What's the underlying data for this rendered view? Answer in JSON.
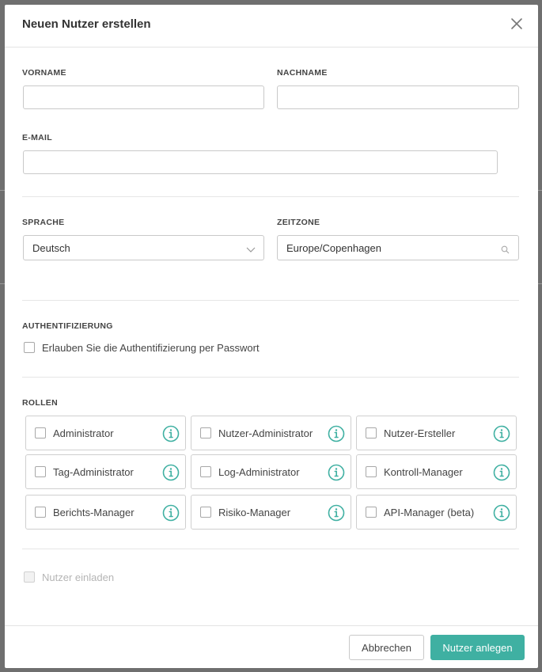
{
  "colors": {
    "accent": "#3fb0a2",
    "border": "#c9c9c9",
    "overlay": "#6f6f6f"
  },
  "modal": {
    "title": "Neuen Nutzer erstellen",
    "close_icon": "close-icon"
  },
  "form": {
    "firstname": {
      "label": "VORNAME",
      "value": "",
      "placeholder": ""
    },
    "lastname": {
      "label": "NACHNAME",
      "value": "",
      "placeholder": ""
    },
    "email": {
      "label": "E-MAIL",
      "value": "",
      "placeholder": ""
    },
    "language": {
      "label": "SPRACHE",
      "value": "Deutsch",
      "icon": "chevron-down-icon"
    },
    "timezone": {
      "label": "ZEITZONE",
      "value": "Europe/Copenhagen",
      "icon": "search-icon"
    },
    "auth": {
      "label": "AUTHENTIFIZIERUNG",
      "password_option": {
        "label": "Erlauben Sie die Authentifizierung per Passwort",
        "checked": false
      }
    },
    "roles": {
      "label": "ROLLEN",
      "items": [
        {
          "label": "Administrator",
          "checked": false,
          "icon": "info-icon"
        },
        {
          "label": "Nutzer-Administrator",
          "checked": false,
          "icon": "info-icon"
        },
        {
          "label": "Nutzer-Ersteller",
          "checked": false,
          "icon": "info-icon"
        },
        {
          "label": "Tag-Administrator",
          "checked": false,
          "icon": "info-icon"
        },
        {
          "label": "Log-Administrator",
          "checked": false,
          "icon": "info-icon"
        },
        {
          "label": "Kontroll-Manager",
          "checked": false,
          "icon": "info-icon"
        },
        {
          "label": "Berichts-Manager",
          "checked": false,
          "icon": "info-icon"
        },
        {
          "label": "Risiko-Manager",
          "checked": false,
          "icon": "info-icon"
        },
        {
          "label": "API-Manager (beta)",
          "checked": false,
          "icon": "info-icon"
        }
      ]
    },
    "invite": {
      "label": "Nutzer einladen",
      "checked": false,
      "disabled": true
    }
  },
  "footer": {
    "cancel_label": "Abbrechen",
    "submit_label": "Nutzer anlegen"
  }
}
